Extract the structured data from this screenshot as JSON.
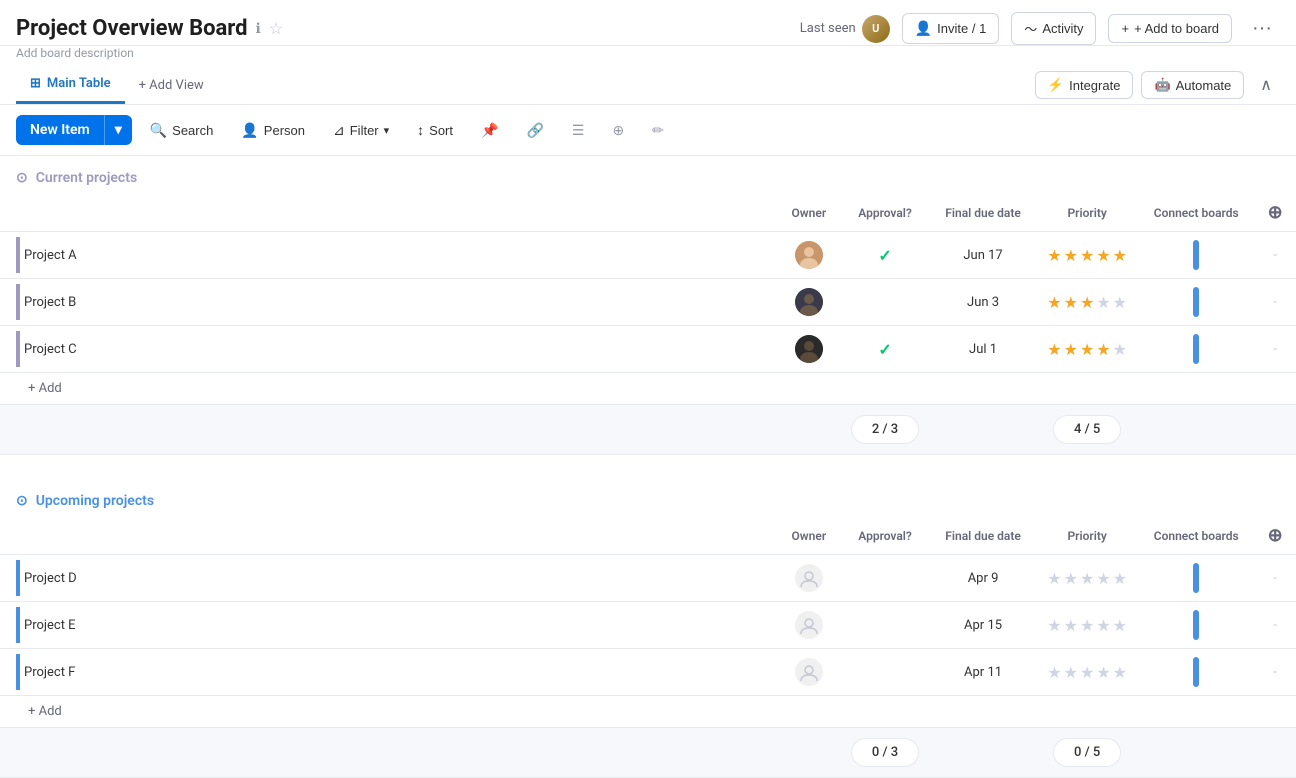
{
  "header": {
    "title": "Project Overview Board",
    "subtitle": "Add board description",
    "last_seen_label": "Last seen",
    "invite_label": "Invite / 1",
    "activity_label": "Activity",
    "add_to_board_label": "+ Add to board"
  },
  "view_tabs": {
    "active_tab": "Main Table",
    "add_view_label": "+ Add View",
    "integrate_label": "Integrate",
    "automate_label": "Automate"
  },
  "toolbar": {
    "new_item_label": "New Item",
    "search_label": "Search",
    "person_label": "Person",
    "filter_label": "Filter",
    "sort_label": "Sort"
  },
  "current_projects": {
    "group_title": "Current projects",
    "columns": {
      "owner": "Owner",
      "approval": "Approval?",
      "due_date": "Final due date",
      "priority": "Priority",
      "connect": "Connect boards"
    },
    "rows": [
      {
        "name": "Project A",
        "owner_initials": "👩",
        "owner_type": "light",
        "approval": true,
        "due_date": "Jun 17",
        "stars": 5,
        "has_bar": true
      },
      {
        "name": "Project B",
        "owner_initials": "👩‍🦱",
        "owner_type": "dark",
        "approval": false,
        "due_date": "Jun 3",
        "stars": 3,
        "has_bar": true
      },
      {
        "name": "Project C",
        "owner_initials": "👨‍🦱",
        "owner_type": "darker",
        "approval": true,
        "due_date": "Jul 1",
        "stars": 4,
        "has_bar": true
      }
    ],
    "add_row_label": "+ Add",
    "summary": {
      "approval_count": "2 / 3",
      "priority_count": "4 / 5"
    }
  },
  "upcoming_projects": {
    "group_title": "Upcoming projects",
    "columns": {
      "owner": "Owner",
      "approval": "Approval?",
      "due_date": "Final due date",
      "priority": "Priority",
      "connect": "Connect boards"
    },
    "rows": [
      {
        "name": "Project D",
        "owner_type": "placeholder",
        "approval": false,
        "due_date": "Apr 9",
        "stars": 0,
        "has_bar": true
      },
      {
        "name": "Project E",
        "owner_type": "placeholder",
        "approval": false,
        "due_date": "Apr 15",
        "stars": 0,
        "has_bar": true
      },
      {
        "name": "Project F",
        "owner_type": "placeholder",
        "approval": false,
        "due_date": "Apr 11",
        "stars": 0,
        "has_bar": true
      }
    ],
    "add_row_label": "+ Add",
    "summary": {
      "approval_count": "0 / 3",
      "priority_count": "0 / 5"
    }
  }
}
